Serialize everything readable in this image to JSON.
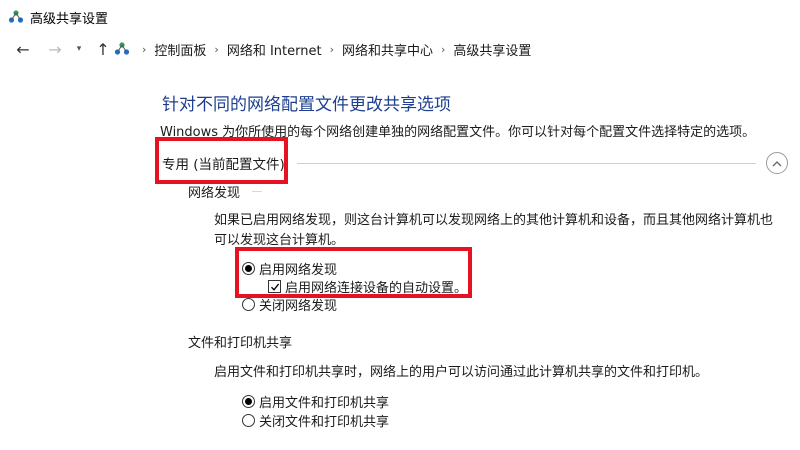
{
  "window": {
    "title": "高级共享设置"
  },
  "nav": {
    "back": "←",
    "forward": "→",
    "recent": "▾",
    "up": "↑",
    "breadcrumbs": [
      "控制面板",
      "网络和 Internet",
      "网络和共享中心",
      "高级共享设置"
    ]
  },
  "content": {
    "heading": "针对不同的网络配置文件更改共享选项",
    "description": "Windows 为你所使用的每个网络创建单独的网络配置文件。你可以针对每个配置文件选择特定的选项。",
    "private_profile": {
      "title": "专用 (当前配置文件)",
      "network_discovery": {
        "title": "网络发现",
        "text": "如果已启用网络发现，则这台计算机可以发现网络上的其他计算机和设备，而且其他网络计算机也可以发现这台计算机。",
        "options": [
          {
            "label": "启用网络发现",
            "selected": true
          },
          {
            "label": "关闭网络发现",
            "selected": false
          }
        ],
        "auto_setup": {
          "label": "启用网络连接设备的自动设置。",
          "checked": true
        }
      },
      "file_printer_sharing": {
        "title": "文件和打印机共享",
        "text": "启用文件和打印机共享时，网络上的用户可以访问通过此计算机共享的文件和打印机。",
        "options": [
          {
            "label": "启用文件和打印机共享",
            "selected": true
          },
          {
            "label": "关闭文件和打印机共享",
            "selected": false
          }
        ]
      }
    }
  },
  "colors": {
    "heading": "#1e3f8f",
    "highlight": "#e5121f"
  },
  "icons": [
    "network-icon",
    "chevron-up-icon",
    "back-arrow-icon",
    "forward-arrow-icon",
    "up-arrow-icon"
  ]
}
